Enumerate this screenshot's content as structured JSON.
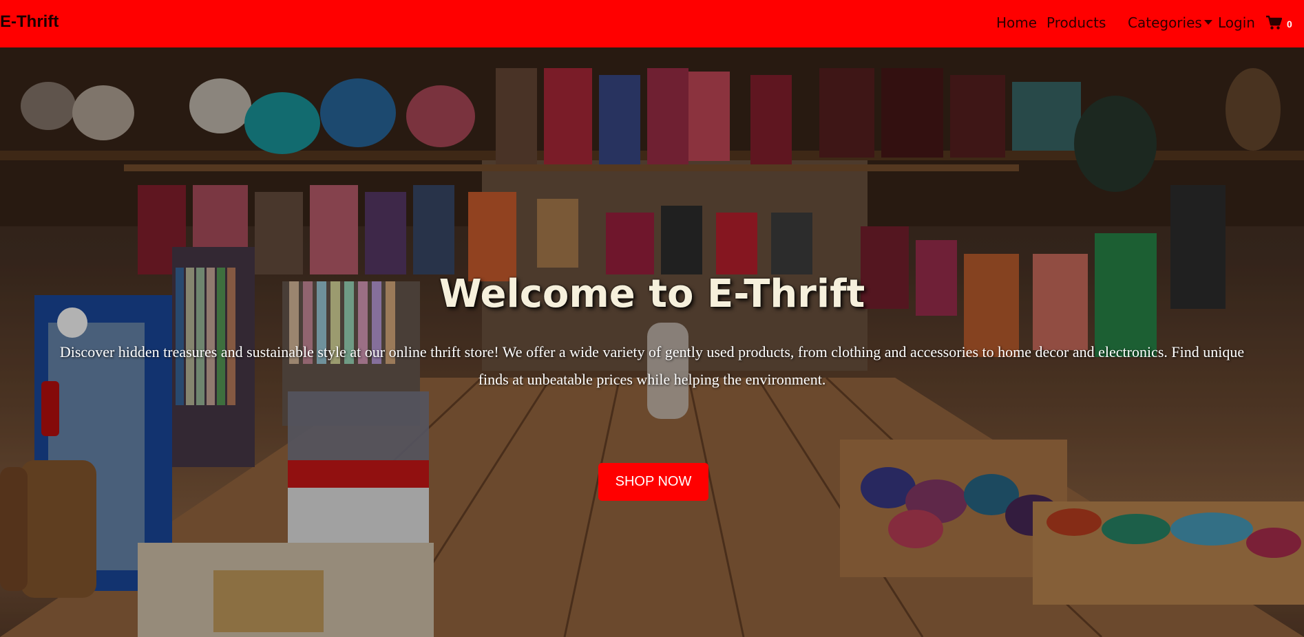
{
  "navbar": {
    "brand": "E-Thrift",
    "links": {
      "home": "Home",
      "products": "Products",
      "categories": "Categories",
      "login": "Login"
    },
    "cart_count": "0",
    "background_color": "#ff0000"
  },
  "hero": {
    "title": "Welcome to E-Thrift",
    "description": "Discover hidden treasures and sustainable style at our online thrift store! We offer a wide variety of gently used products, from clothing and accessories to home decor and electronics. Find unique finds at unbeatable prices while helping the environment.",
    "cta_label": "SHOP NOW",
    "cta_color": "#ff0000",
    "background": "market-stall-photo"
  },
  "icons": {
    "cart": "shopping-cart-icon",
    "dropdown": "caret-down-icon"
  }
}
